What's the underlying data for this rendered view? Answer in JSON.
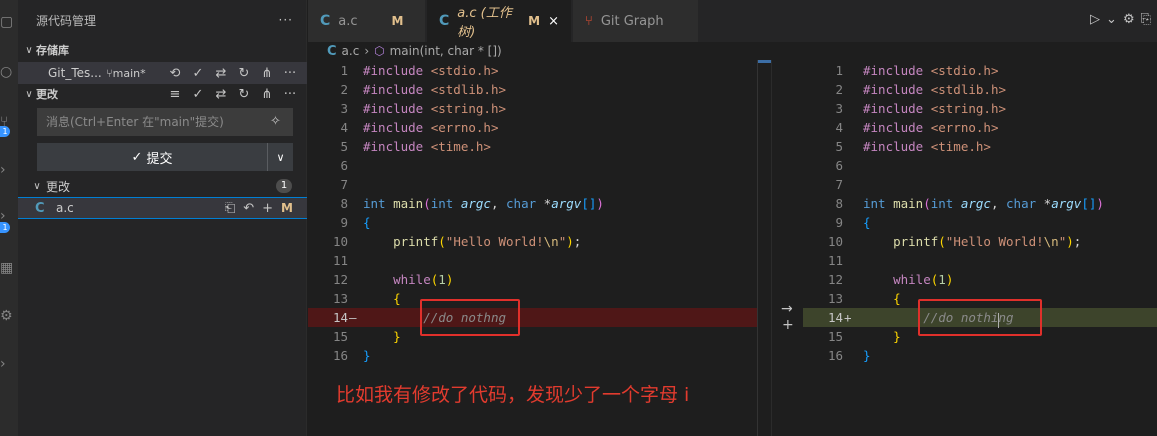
{
  "sidebar": {
    "title": "源代码管理",
    "repos_label": "存储库",
    "repo_name": "Git_Tes...",
    "repo_branch": "main*",
    "changes_section_label": "更改",
    "message_placeholder": "消息(Ctrl+Enter 在\"main\"提交)",
    "commit_label": "提交",
    "changes_group_label": "更改",
    "changes_count": "1",
    "file": {
      "name": "a.c",
      "status": "M"
    }
  },
  "activity": {
    "badges": [
      "1",
      "1"
    ]
  },
  "tabs": [
    {
      "label": "a.c",
      "status": "M"
    },
    {
      "label": "a.c (工作树)",
      "status": "M",
      "close": "×"
    },
    {
      "label": "Git Graph"
    }
  ],
  "breadcrumb": {
    "file": "a.c",
    "symbol": "main(int, char * [])"
  },
  "editor": {
    "line_numbers": [
      "1",
      "2",
      "3",
      "4",
      "5",
      "6",
      "7",
      "8",
      "9",
      "10",
      "11",
      "12",
      "13",
      "14",
      "15",
      "16"
    ],
    "includes": [
      "<stdio.h>",
      "<stdlib.h>",
      "<string.h>",
      "<errno.h>",
      "<time.h>"
    ],
    "include_kw": "#include",
    "main_sig": {
      "ret": "int",
      "name": "main",
      "p1_type": "int",
      "p1": "argc",
      "p2_type": "char",
      "p2_ptr": "*",
      "p2": "argv",
      "brackets": "[]"
    },
    "printf": {
      "name": "printf",
      "str_a": "\"Hello World!",
      "esc": "\\n",
      "str_b": "\""
    },
    "while_kw": "while",
    "while_arg": "1",
    "left_comment": "//do nothng",
    "right_comment": "//do nothing",
    "left_diff_marker": "—",
    "right_diff_marker": "+"
  },
  "annotation": "比如我有修改了代码，发现少了一个字母 i"
}
